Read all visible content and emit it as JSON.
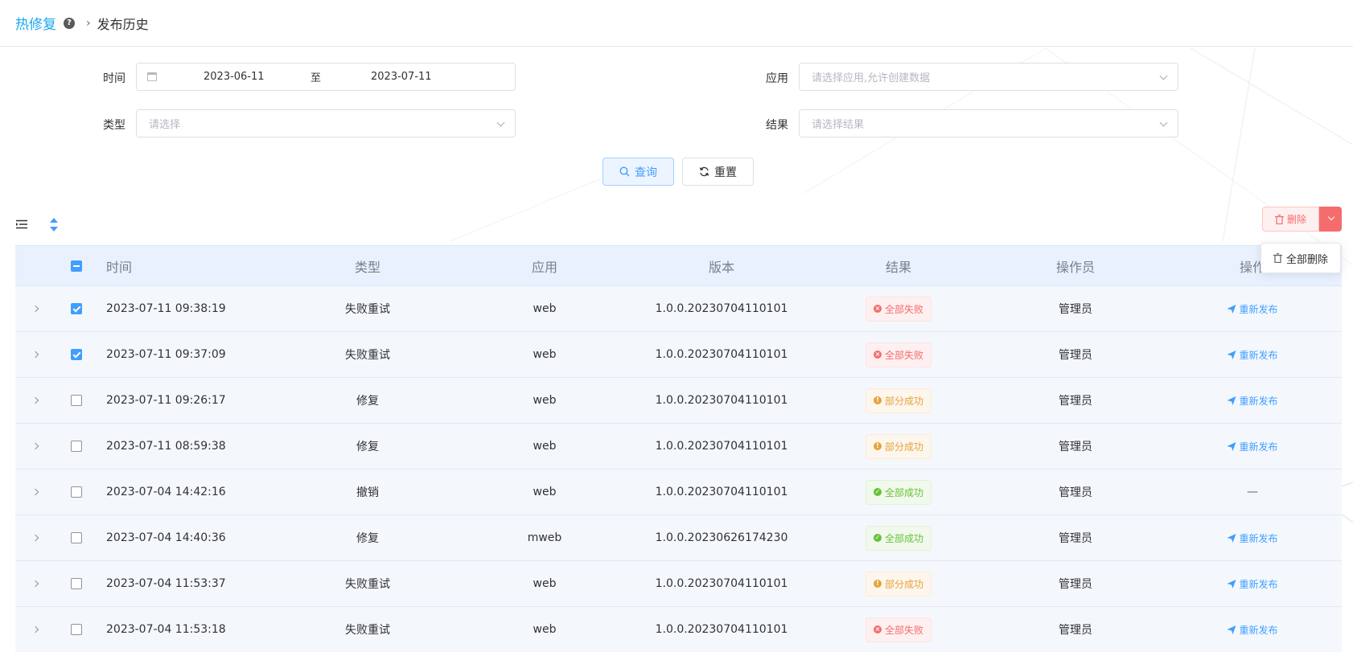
{
  "breadcrumb": {
    "root": "热修复",
    "current": "发布历史"
  },
  "filters": {
    "time_label": "时间",
    "date_start": "2023-06-11",
    "date_sep": "至",
    "date_end": "2023-07-11",
    "app_label": "应用",
    "app_placeholder": "请选择应用,允许创建数据",
    "type_label": "类型",
    "type_placeholder": "请选择",
    "result_label": "结果",
    "result_placeholder": "请选择结果",
    "query_label": "查询",
    "reset_label": "重置"
  },
  "toolbar": {
    "delete_label": "删除",
    "dropdown_item": "全部删除"
  },
  "table": {
    "columns": [
      "时间",
      "类型",
      "应用",
      "版本",
      "结果",
      "操作员",
      "操作"
    ],
    "rows": [
      {
        "time": "2023-07-11 09:38:19",
        "type": "失败重试",
        "app": "web",
        "version": "1.0.0.20230704110101",
        "result": "全部失败",
        "status": "fail",
        "operator": "管理员",
        "action": "重新发布",
        "checked": true
      },
      {
        "time": "2023-07-11 09:37:09",
        "type": "失败重试",
        "app": "web",
        "version": "1.0.0.20230704110101",
        "result": "全部失败",
        "status": "fail",
        "operator": "管理员",
        "action": "重新发布",
        "checked": true
      },
      {
        "time": "2023-07-11 09:26:17",
        "type": "修复",
        "app": "web",
        "version": "1.0.0.20230704110101",
        "result": "部分成功",
        "status": "part",
        "operator": "管理员",
        "action": "重新发布",
        "checked": false
      },
      {
        "time": "2023-07-11 08:59:38",
        "type": "修复",
        "app": "web",
        "version": "1.0.0.20230704110101",
        "result": "部分成功",
        "status": "part",
        "operator": "管理员",
        "action": "重新发布",
        "checked": false
      },
      {
        "time": "2023-07-04 14:42:16",
        "type": "撤销",
        "app": "web",
        "version": "1.0.0.20230704110101",
        "result": "全部成功",
        "status": "ok",
        "operator": "管理员",
        "action": "—",
        "checked": false
      },
      {
        "time": "2023-07-04 14:40:36",
        "type": "修复",
        "app": "mweb",
        "version": "1.0.0.20230626174230",
        "result": "全部成功",
        "status": "ok",
        "operator": "管理员",
        "action": "重新发布",
        "checked": false
      },
      {
        "time": "2023-07-04 11:53:37",
        "type": "失败重试",
        "app": "web",
        "version": "1.0.0.20230704110101",
        "result": "部分成功",
        "status": "part",
        "operator": "管理员",
        "action": "重新发布",
        "checked": false
      },
      {
        "time": "2023-07-04 11:53:18",
        "type": "失败重试",
        "app": "web",
        "version": "1.0.0.20230704110101",
        "result": "全部失败",
        "status": "fail",
        "operator": "管理员",
        "action": "重新发布",
        "checked": false
      }
    ]
  }
}
